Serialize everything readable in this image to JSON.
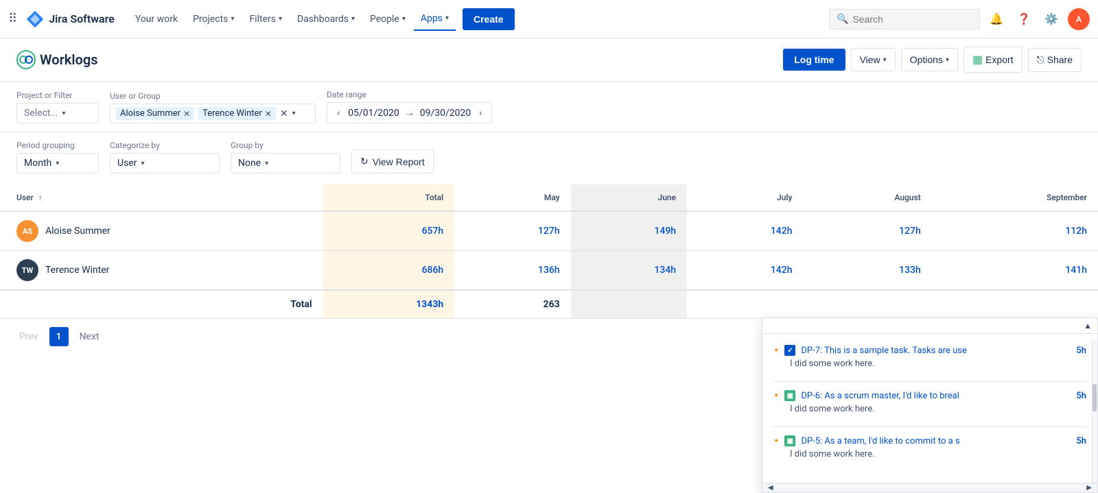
{
  "topnav": {
    "logo_text": "Jira Software",
    "items": [
      {
        "id": "your-work",
        "label": "Your work",
        "active": false
      },
      {
        "id": "projects",
        "label": "Projects",
        "has_arrow": true,
        "active": false
      },
      {
        "id": "filters",
        "label": "Filters",
        "has_arrow": true,
        "active": false
      },
      {
        "id": "dashboards",
        "label": "Dashboards",
        "has_arrow": true,
        "active": false
      },
      {
        "id": "people",
        "label": "People",
        "has_arrow": true,
        "active": false
      },
      {
        "id": "apps",
        "label": "Apps",
        "has_arrow": true,
        "active": true
      }
    ],
    "create_label": "Create",
    "search_placeholder": "Search"
  },
  "worklogs": {
    "title": "Worklogs",
    "log_time_label": "Log time",
    "view_label": "View",
    "options_label": "Options",
    "export_label": "Export",
    "share_label": "Share"
  },
  "filters": {
    "project_or_filter_label": "Project or Filter",
    "project_placeholder": "Select...",
    "user_or_group_label": "User or Group",
    "tags": [
      {
        "id": "aloise",
        "text": "Aloise Summer"
      },
      {
        "id": "terence",
        "text": "Terence Winter"
      }
    ],
    "date_range_label": "Date range",
    "date_from": "05/01/2020",
    "date_to": "09/30/2020"
  },
  "options": {
    "period_grouping_label": "Period grouping",
    "period_grouping_value": "Month",
    "categorize_by_label": "Categorize by",
    "categorize_by_value": "User",
    "group_by_label": "Group by",
    "group_by_value": "None",
    "view_report_label": "View Report"
  },
  "table": {
    "col_user": "User",
    "col_sort_indicator": "↑",
    "col_total": "Total",
    "col_may": "May",
    "col_june": "June",
    "col_july": "July",
    "col_august": "August",
    "col_september": "September",
    "rows": [
      {
        "id": "aloise",
        "avatar_initials": "AS",
        "avatar_type": "as",
        "name": "Aloise Summer",
        "total": "657h",
        "may": "127h",
        "june": "149h",
        "july": "142h",
        "august": "127h",
        "september": "112h"
      },
      {
        "id": "terence",
        "avatar_initials": "TW",
        "avatar_type": "tw",
        "name": "Terence Winter",
        "total": "686h",
        "may": "136h",
        "june": "134h",
        "july": "142h",
        "august": "133h",
        "september": "141h"
      }
    ],
    "total_label": "Total",
    "total_value": "1343h",
    "total_may": "263"
  },
  "pagination": {
    "prev_label": "Prev",
    "current_page": "1",
    "next_label": "Next"
  },
  "popup": {
    "items": [
      {
        "id": "dp7",
        "icon_type": "blue",
        "icon_char": "✓",
        "task_id": "DP-7",
        "task_text": "DP-7: This is a sample task. Tasks are use",
        "time": "5h",
        "note": "I did some work here."
      },
      {
        "id": "dp6",
        "icon_type": "green",
        "icon_char": "▣",
        "task_id": "DP-6",
        "task_text": "DP-6: As a scrum master, I'd like to breal",
        "time": "5h",
        "note": "I did some work here."
      },
      {
        "id": "dp5",
        "icon_type": "green",
        "icon_char": "▣",
        "task_id": "DP-5",
        "task_text": "DP-5: As a team, I'd like to commit to a s",
        "time": "5h",
        "note": "I did some work here."
      }
    ]
  }
}
